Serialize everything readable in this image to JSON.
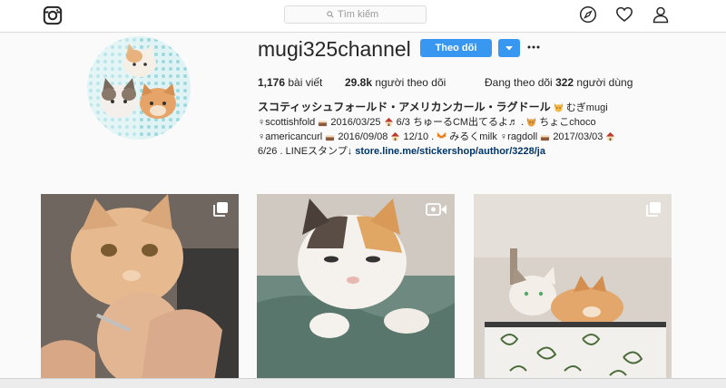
{
  "topbar": {
    "logo_icon": "instagram-logo-icon",
    "search": {
      "placeholder": "Tìm kiếm"
    },
    "nav_icons": [
      "compass-icon",
      "heart-icon",
      "person-icon"
    ]
  },
  "profile": {
    "username": "mugi325channel",
    "follow_label": "Theo dõi",
    "stats": {
      "posts_count": "1,176",
      "posts_label": " bài viết",
      "followers_count": "29.8k",
      "followers_label": " người theo dõi",
      "following_prefix": "Đang theo dõi ",
      "following_count": "322",
      "following_label": " người dùng"
    },
    "bio": {
      "name": "スコティッシュフォールド・アメリカンカール・ラグドール",
      "line1_tail": "むぎmugi",
      "line2_a": "♀scottishfold",
      "line2_b": "2016/03/25",
      "line2_c": "6/3 ちゅーるCM出てるよ♬ .",
      "line2_d": "ちょこchoco",
      "line3_a": "♀americancurl",
      "line3_b": "2016/09/08",
      "line3_c": "12/10 .",
      "line3_d": "みるくmilk ♀ragdoll",
      "line3_e": "2017/03/03",
      "line4_a": "6/26 . LINEスタンプ↓",
      "link": "store.line.me/stickershop/author/3228/ja"
    }
  },
  "posts": [
    {
      "type_icon": "multiple-photos-icon"
    },
    {
      "type_icon": "video-icon"
    },
    {
      "type_icon": "multiple-photos-icon"
    }
  ],
  "colors": {
    "accent": "#3897f0",
    "link": "#003569",
    "border": "#dbdbdb"
  }
}
